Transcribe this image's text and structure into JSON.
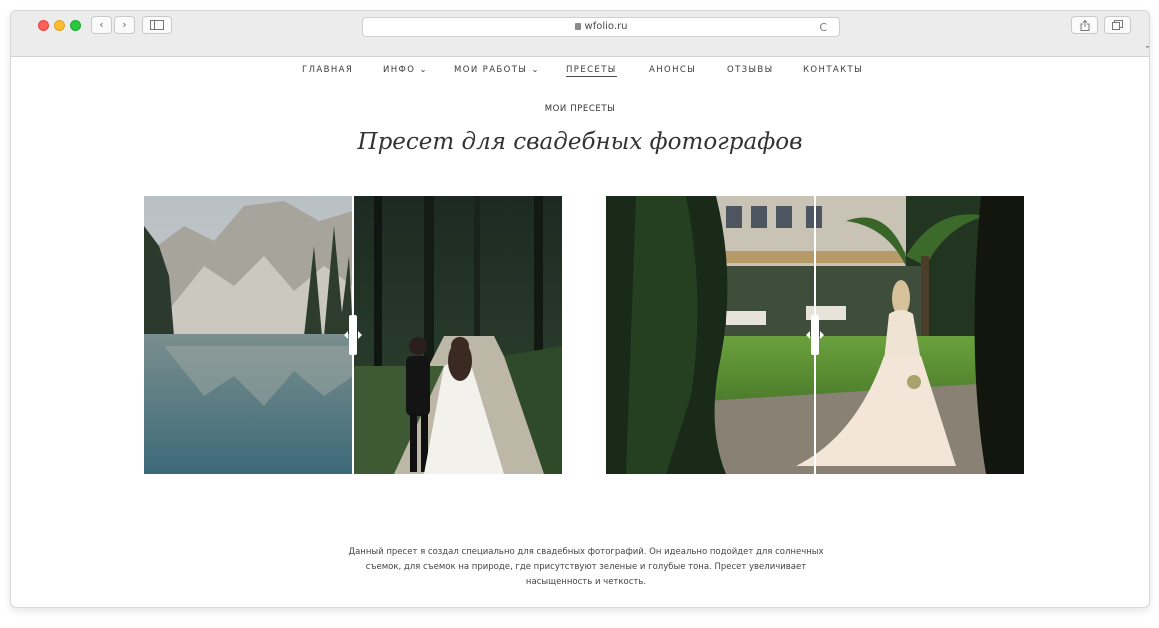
{
  "browser": {
    "url": "wfolio.ru",
    "reload_glyph": "C",
    "back_glyph": "‹",
    "forward_glyph": "›",
    "plus_glyph": "+"
  },
  "site_nav": {
    "items": [
      {
        "label": "ГЛАВНАЯ"
      },
      {
        "label": "ИНФО ⌄"
      },
      {
        "label": "МОИ РАБОТЫ ⌄"
      },
      {
        "label": "ПРЕСЕТЫ"
      },
      {
        "label": "АНОНСЫ"
      },
      {
        "label": "ОТЗЫВЫ"
      },
      {
        "label": "КОНТАКТЫ"
      }
    ],
    "active_index": 3
  },
  "page": {
    "subtitle": "МОИ ПРЕСЕТЫ",
    "title": "Пресет для свадебных фотографов",
    "description_lines": [
      "Данный пресет я создал специально для свадебных фотографий. Он идеально подойдет для солнечных",
      "съемок, для съемок на природе, где присутствуют зеленые и голубые тона. Пресет увеличивает",
      "насыщенность и четкость."
    ]
  },
  "comparisons": [
    {
      "subject": "mountain lake wedding couple",
      "divider_position": 0.5
    },
    {
      "subject": "bride in garden",
      "divider_position": 0.5
    }
  ],
  "icons": {
    "back": "chevron-left-icon",
    "forward": "chevron-right-icon",
    "sidebar": "sidebar-icon",
    "share": "share-icon",
    "tabs": "tabs-icon",
    "new_tab": "plus-icon",
    "lock": "lock-icon",
    "reload": "reload-icon"
  }
}
